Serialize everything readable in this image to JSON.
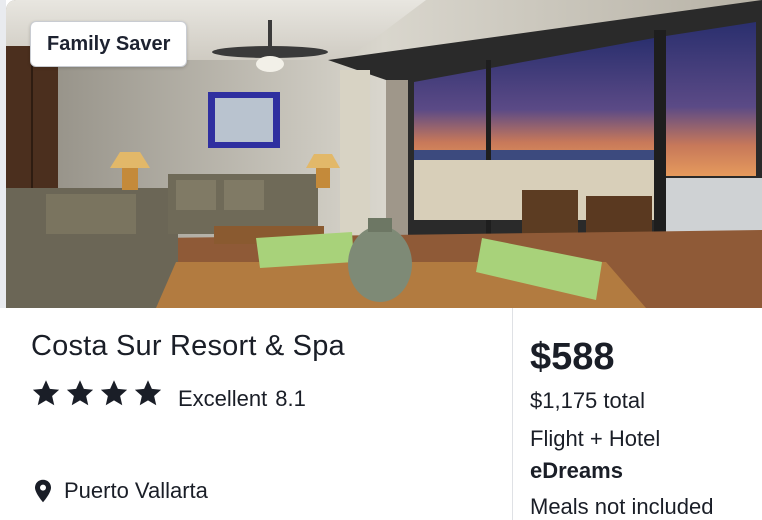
{
  "badge": {
    "label": "Family Saver"
  },
  "hotel": {
    "name": "Costa Sur Resort & Spa",
    "star_count": 4,
    "rating_word": "Excellent",
    "rating_score": "8.1",
    "location": "Puerto Vallarta"
  },
  "pricing": {
    "price": "$588",
    "total": "$1,175 total",
    "package": "Flight + Hotel",
    "provider": "eDreams",
    "meals": "Meals not included"
  },
  "icons": {
    "star": "star-icon",
    "location": "map-pin-icon"
  },
  "colors": {
    "text": "#1a1e27",
    "divider": "#dfe1e5",
    "badge_bg": "#ffffff"
  }
}
